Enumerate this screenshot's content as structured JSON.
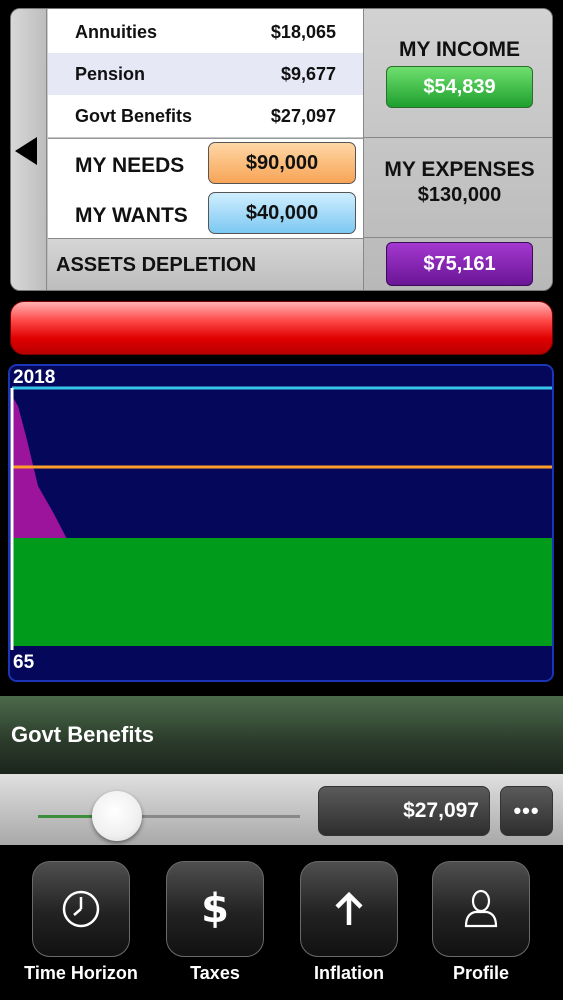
{
  "income": {
    "rows": [
      {
        "label": "Annuities",
        "value": "$18,065"
      },
      {
        "label": "Pension",
        "value": "$9,677"
      },
      {
        "label": "Govt Benefits",
        "value": "$27,097"
      }
    ],
    "title": "MY INCOME",
    "total": "$54,839"
  },
  "needs": {
    "label": "MY NEEDS",
    "value": "$90,000"
  },
  "wants": {
    "label": "MY WANTS",
    "value": "$40,000"
  },
  "expenses": {
    "title": "MY EXPENSES",
    "total": "$130,000"
  },
  "assets": {
    "label": "ASSETS DEPLETION",
    "value": "$75,161"
  },
  "chart": {
    "top_label": "2018",
    "bottom_label": "65",
    "colors": {
      "background": "#05085a",
      "income": "#009b1b",
      "assets": "#9b149b",
      "needs_line": "#ff9f2b",
      "expenses_line": "#37c6ea"
    }
  },
  "detail": {
    "title": "Govt Benefits",
    "value": "$27,097",
    "more": "•••",
    "slider_fraction": 0.3
  },
  "tabs": [
    {
      "label": "Time Horizon",
      "icon": "clock-icon"
    },
    {
      "label": "Taxes",
      "icon": "dollar-icon"
    },
    {
      "label": "Inflation",
      "icon": "up-arrow-icon"
    },
    {
      "label": "Profile",
      "icon": "person-icon"
    }
  ]
}
